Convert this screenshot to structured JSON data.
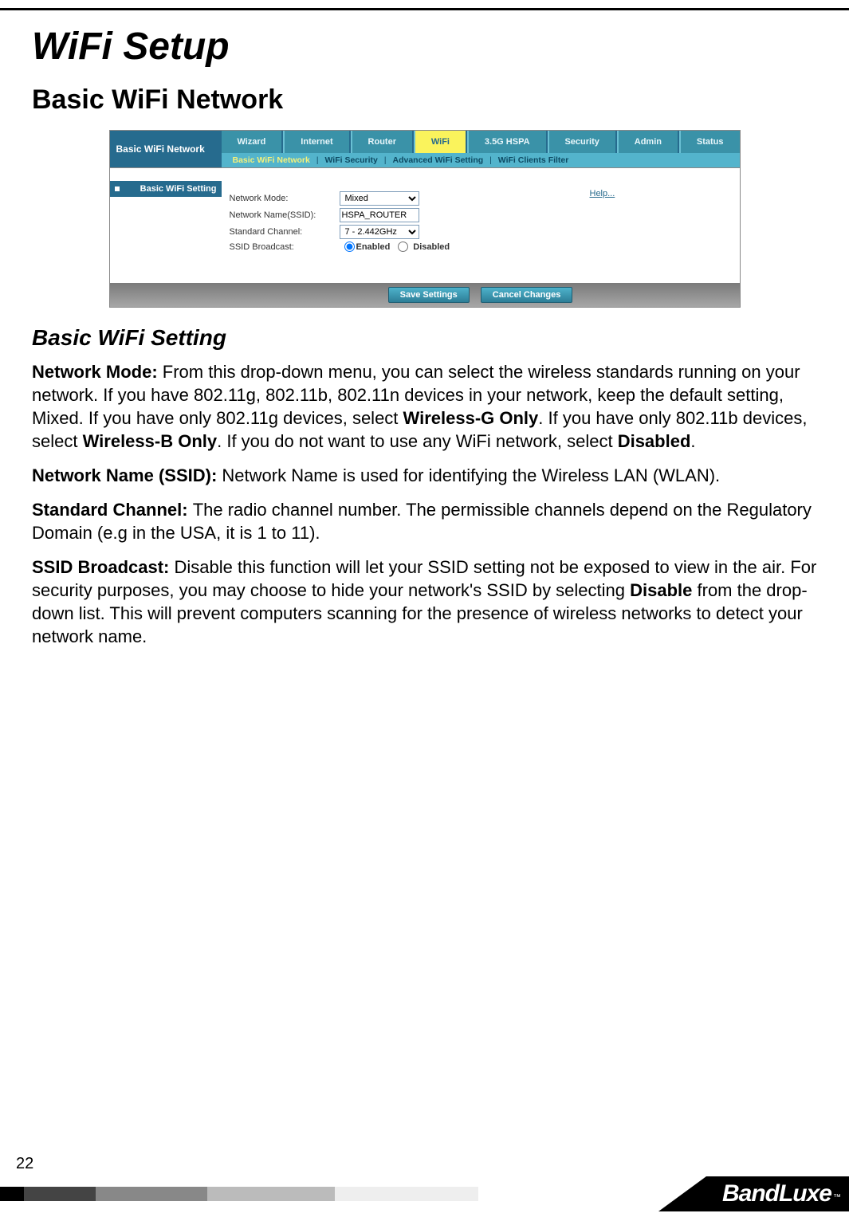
{
  "page_number": "22",
  "main_title": "WiFi Setup",
  "section_title": "Basic WiFi Network",
  "sub_title": "Basic WiFi Setting",
  "brand": "BandLuxe",
  "brand_tm": "™",
  "screenshot": {
    "left_title": "Basic WiFi Network",
    "left_sub": "Basic WiFi Setting",
    "help": "Help...",
    "tabs": [
      "Wizard",
      "Internet",
      "Router",
      "WiFi",
      "3.5G HSPA",
      "Security",
      "Admin",
      "Status"
    ],
    "active_tab_index": 3,
    "subtabs": [
      "Basic WiFi Network",
      "WiFi Security",
      "Advanced WiFi Setting",
      "WiFi Clients Filter"
    ],
    "active_subtab_index": 0,
    "form": {
      "network_mode_label": "Network Mode:",
      "network_mode_value": "Mixed",
      "network_name_label": "Network Name(SSID):",
      "network_name_value": "HSPA_ROUTER",
      "standard_channel_label": "Standard Channel:",
      "standard_channel_value": "7 - 2.442GHz",
      "ssid_broadcast_label": "SSID Broadcast:",
      "ssid_enabled": "Enabled",
      "ssid_disabled": "Disabled"
    },
    "buttons": {
      "save": "Save Settings",
      "cancel": "Cancel Changes"
    }
  },
  "paragraphs": {
    "p1_lead": "Network Mode: ",
    "p1_body_a": "From this drop-down menu, you can select the wireless standards running on your network. If you have 802.11g, 802.11b, 802.11n devices in your network, keep the default setting, Mixed. If you have only 802.11g devices, select ",
    "p1_b1": "Wireless-G Only",
    "p1_body_b": ". If you have only 802.11b devices, select ",
    "p1_b2": "Wireless-B Only",
    "p1_body_c": ". If you do not want to use any WiFi network, select ",
    "p1_b3": "Disabled",
    "p1_body_d": ".",
    "p2_lead": "Network Name (SSID): ",
    "p2_body": "Network Name is used for identifying the Wireless LAN (WLAN).",
    "p3_lead": "Standard Channel: ",
    "p3_body": "The radio channel number. The permissible channels depend on the Regulatory Domain (e.g in the USA, it is 1 to 11).",
    "p4_lead": "SSID Broadcast: ",
    "p4_body_a": "Disable this function will let your SSID setting not be exposed to view in the air. For security purposes, you may choose to hide your network's SSID by selecting ",
    "p4_b1": "Disable",
    "p4_body_b": " from the drop-down list. This will prevent computers scanning for the presence of wireless networks to detect your network name."
  }
}
